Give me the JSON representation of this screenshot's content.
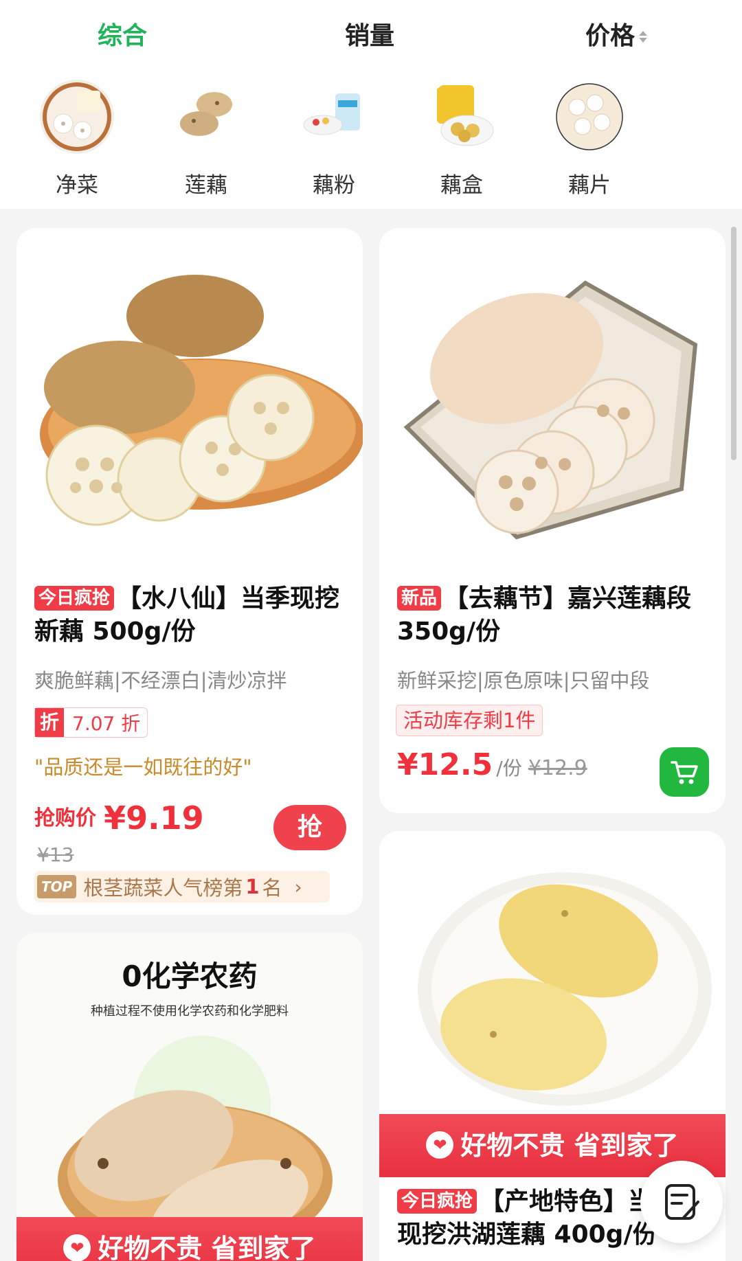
{
  "sort_tabs": {
    "comprehensive": "综合",
    "sales": "销量",
    "price": "价格"
  },
  "categories": [
    {
      "label": "净菜",
      "icon": "cut-lotus-root-icon"
    },
    {
      "label": "莲藕",
      "icon": "lotus-root-icon"
    },
    {
      "label": "藕粉",
      "icon": "lotus-powder-icon"
    },
    {
      "label": "藕盒",
      "icon": "lotus-box-icon"
    },
    {
      "label": "藕片",
      "icon": "lotus-slices-icon"
    }
  ],
  "products": [
    {
      "tag": "今日疯抢",
      "title": "【水八仙】当季现挖新藕 500g/份",
      "subtitle": "爽脆鲜藕|不经漂白|清炒凉拌",
      "discount_icon": "折",
      "discount_text": "7.07 折",
      "review": "\"品质还是一如既往的好\"",
      "price_label": "抢购价",
      "price": "¥9.19",
      "original_price": "¥13",
      "buy_button": "抢",
      "rank_badge": "TOP",
      "rank_text": "根茎蔬菜人气榜第",
      "rank_number": "1",
      "rank_suffix": "名",
      "rank_arrow": "›"
    },
    {
      "tag": "新品",
      "title": "【去藕节】嘉兴莲藕段 350g/份",
      "subtitle": "新鲜采挖|原色原味|只留中段",
      "stock": "活动库存剩1件",
      "price": "¥12.5",
      "unit": "/份",
      "original_price": "¥12.9"
    },
    {
      "image_headline": "0化学农药",
      "image_subline": "种植过程不使用化学农药和化学肥料",
      "banner": "好物不贵 省到家了"
    },
    {
      "banner": "好物不贵 省到家了",
      "tag": "今日疯抢",
      "title": "【产地特色】当季现挖洪湖莲藕 400g/份"
    }
  ],
  "colors": {
    "accent_green": "#22b35a",
    "price_red": "#f0303a",
    "tag_red": "#f03c46"
  }
}
